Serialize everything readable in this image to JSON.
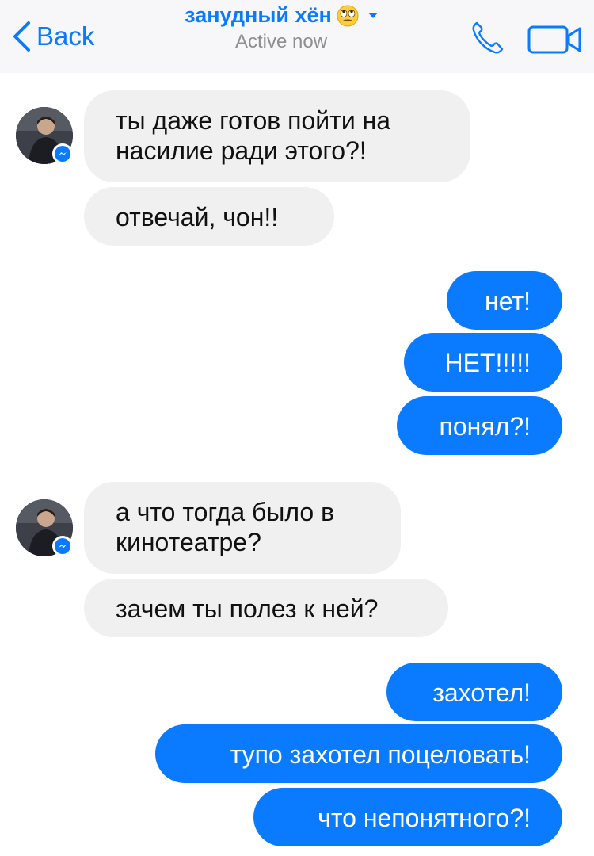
{
  "header": {
    "back_label": "Back",
    "contact_name": "занудный хён",
    "status": "Active now"
  },
  "messages": [
    {
      "from": "incoming",
      "text": "ты даже готов пойти на насилие ради этого?!"
    },
    {
      "from": "incoming",
      "text": "отвечай, чон!!"
    },
    {
      "from": "outgoing",
      "text": "нет!"
    },
    {
      "from": "outgoing",
      "text": "НЕТ!!!!!"
    },
    {
      "from": "outgoing",
      "text": "понял?!"
    },
    {
      "from": "incoming",
      "text": "а что тогда было в кинотеатре?"
    },
    {
      "from": "incoming",
      "text": "зачем ты полез к ней?"
    },
    {
      "from": "outgoing",
      "text": "захотел!"
    },
    {
      "from": "outgoing",
      "text": "тупо захотел поцеловать!"
    },
    {
      "from": "outgoing",
      "text": "что непонятного?!"
    }
  ],
  "colors": {
    "accent": "#0a7bff",
    "incoming_bubble": "#f1f0f0",
    "outgoing_bubble": "#0a7bff",
    "header_bg": "#f7f7f9"
  },
  "icons": [
    "chevron-left-icon",
    "rolling-eyes-emoji-icon",
    "chevron-down-icon",
    "phone-icon",
    "video-camera-icon",
    "messenger-badge-icon"
  ]
}
